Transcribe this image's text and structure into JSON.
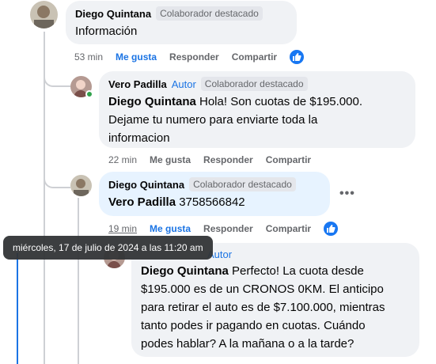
{
  "comment1": {
    "author": "Diego Quintana",
    "badge": "Colaborador destacado",
    "text": "Información",
    "time": "53 min",
    "like": "Me gusta",
    "reply": "Responder",
    "share": "Compartir",
    "reaction_icon": "like-icon"
  },
  "comment2": {
    "author": "Vero Padilla",
    "author_badge": "Autor",
    "badge": "Colaborador destacado",
    "mention": "Diego Quintana",
    "text_line1": " Hola! Son cuotas de $195.000.",
    "text_line2": "Dejame tu numero para enviarte toda la",
    "text_line3": "informacion",
    "time": "22 min",
    "like": "Me gusta",
    "reply": "Responder",
    "share": "Compartir"
  },
  "comment3": {
    "author": "Diego Quintana",
    "badge": "Colaborador destacado",
    "mention": "Vero Padilla",
    "text": " 3758566842",
    "time": "19 min",
    "like": "Me gusta",
    "reply": "Responder",
    "share": "Compartir",
    "more": "•••",
    "reaction_icon": "like-icon"
  },
  "comment4": {
    "author_badge": "Autor",
    "mention": "Diego Quintana",
    "text_line1": " Perfecto! La cuota desde",
    "text_line2": "$195.000 es de un CRONOS 0KM. El anticipo",
    "text_line3": "para retirar el auto es de $7.100.000, mientras",
    "text_line4": "tanto podes ir pagando en cuotas. Cuándo",
    "text_line5": "podes hablar? A la mañana o a la tarde?"
  },
  "tooltip": {
    "text": "miércoles, 17 de julio de 2024 a las 11:20 am"
  },
  "colors": {
    "accent": "#1b74e4",
    "bubble": "#f0f2f5",
    "bubble_hover": "#e7f3ff",
    "online": "#31a24c"
  }
}
